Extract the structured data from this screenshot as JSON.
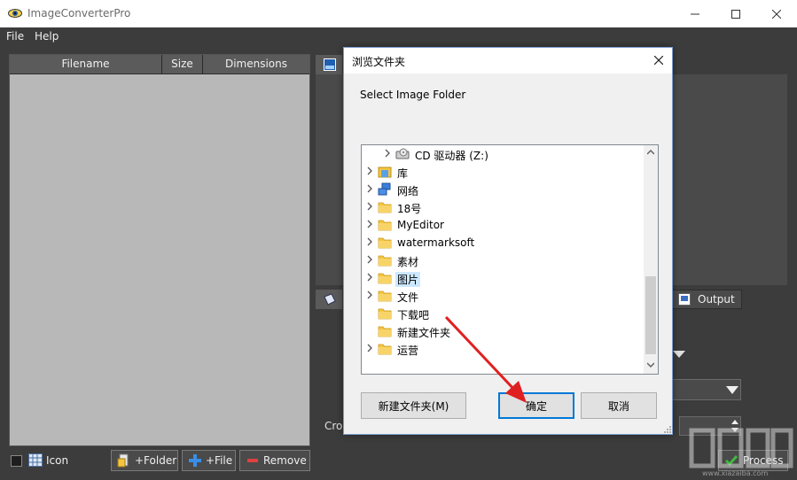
{
  "window": {
    "title": "ImageConverterPro"
  },
  "menu": {
    "file": "File",
    "help": "Help"
  },
  "filelist": {
    "columns": [
      "Filename",
      "Size",
      "Dimensions"
    ]
  },
  "bottom": {
    "icon_label": "Icon",
    "add_folder": "+Folder",
    "add_file": "+File",
    "remove": "Remove",
    "process": "Process"
  },
  "right": {
    "output_tab": "Output",
    "crop_label": "Cro"
  },
  "dialog": {
    "title": "浏览文件夹",
    "prompt": "Select Image Folder",
    "tree": [
      {
        "label": "CD 驱动器 (Z:)",
        "icon": "cd-drive-icon",
        "arrow": true
      },
      {
        "label": "库",
        "icon": "library-icon",
        "arrow": true
      },
      {
        "label": "网络",
        "icon": "network-icon",
        "arrow": true
      },
      {
        "label": "18号",
        "icon": "folder-icon",
        "arrow": true
      },
      {
        "label": "MyEditor",
        "icon": "folder-icon",
        "arrow": true
      },
      {
        "label": "watermarksoft",
        "icon": "folder-icon",
        "arrow": true
      },
      {
        "label": "素材",
        "icon": "folder-icon",
        "arrow": true
      },
      {
        "label": "图片",
        "icon": "folder-icon",
        "arrow": true,
        "selected": true
      },
      {
        "label": "文件",
        "icon": "folder-icon",
        "arrow": true
      },
      {
        "label": "下载吧",
        "icon": "folder-icon",
        "arrow": false
      },
      {
        "label": "新建文件夹",
        "icon": "folder-icon",
        "arrow": false
      },
      {
        "label": "运营",
        "icon": "folder-icon",
        "arrow": true
      }
    ],
    "new_folder": "新建文件夹(M)",
    "ok": "确定",
    "cancel": "取消"
  },
  "watermark": {
    "text": "www.xiazaiba.com"
  },
  "colors": {
    "accent": "#0078d7",
    "selection": "#cce8ff",
    "arrow": "#e02020",
    "folder": "#f5c542"
  }
}
